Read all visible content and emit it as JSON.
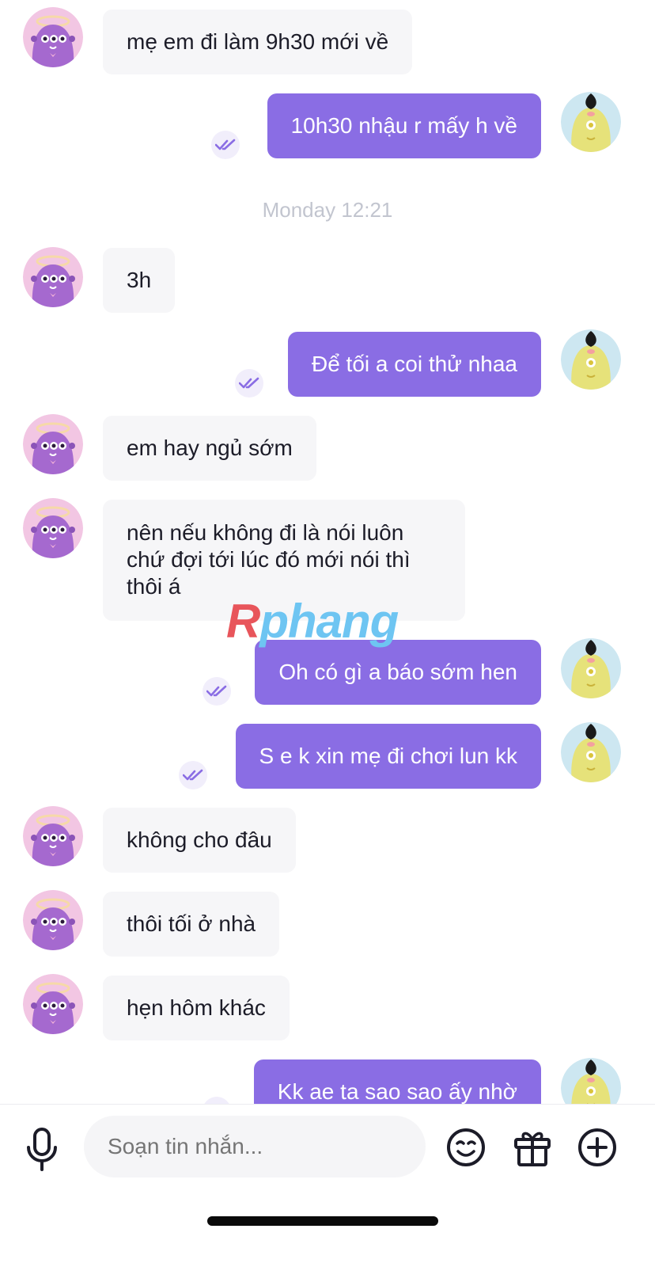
{
  "colors": {
    "outgoing_bubble": "#8a6de4",
    "incoming_bubble": "#f6f6f8",
    "read_tick": "#8a6de4",
    "day_stamp": "#c2c5cf"
  },
  "day_stamp": "Monday 12:21",
  "messages": [
    {
      "from": "them",
      "text": "mẹ em đi làm 9h30 mới về"
    },
    {
      "from": "me",
      "text": "10h30 nhậu r mấy h về",
      "status_icon": "read-double-check-icon"
    },
    {
      "from": "them",
      "text": "3h"
    },
    {
      "from": "me",
      "text": "Để tối a coi thử nhaa",
      "status_icon": "read-double-check-icon"
    },
    {
      "from": "them",
      "text": "em hay ngủ sớm"
    },
    {
      "from": "them",
      "text": "nên nếu không đi là nói luôn chứ đợi tới lúc đó mới nói thì thôi á"
    },
    {
      "from": "me",
      "text": "Oh có gì a báo sớm hen",
      "status_icon": "read-double-check-icon"
    },
    {
      "from": "me",
      "text": "S e k xin mẹ đi chơi lun kk",
      "status_icon": "read-double-check-icon"
    },
    {
      "from": "them",
      "text": "không cho đâu"
    },
    {
      "from": "them",
      "text": "thôi tối ở nhà"
    },
    {
      "from": "them",
      "text": "hẹn hôm khác"
    },
    {
      "from": "me",
      "text": "Kk ae ta sao sao ấy nhờ",
      "status_icon": "read-double-check-icon"
    }
  ],
  "watermark": {
    "first": "R",
    "rest": "phang"
  },
  "composer": {
    "placeholder": "Soạn tin nhắn...",
    "icons": [
      "microphone-icon",
      "emoji-icon",
      "gift-icon",
      "add-circle-icon"
    ]
  }
}
